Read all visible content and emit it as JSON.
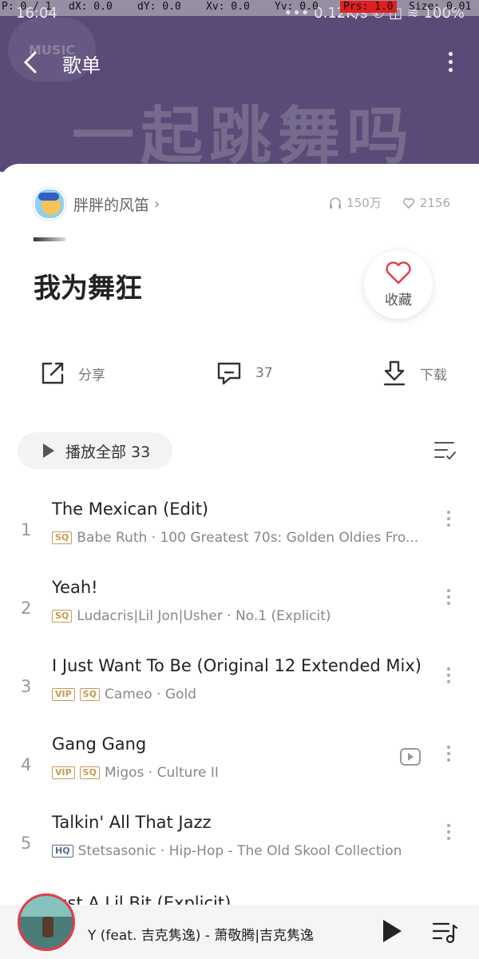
{
  "debug": {
    "p": "P: 0 / 1",
    "dx": "dX: 0.0",
    "dy": "dY: 0.0",
    "xv": "Xv: 0.0",
    "yv": "Yv: 0.0",
    "prs": "Prs: 1.0",
    "size": "Size: 0.01"
  },
  "status": {
    "time": "16:04",
    "right": "••• 0.12K/s  ✆  ◫  ≋  100%"
  },
  "header": {
    "logo_text": "MUSIC",
    "title": "歌单",
    "background_title": "一起跳舞吗"
  },
  "creator": {
    "name": "胖胖的风笛",
    "plays": "150万",
    "likes": "2156"
  },
  "playlist": {
    "title": "我为舞狂",
    "favorite_label": "收藏"
  },
  "actions": {
    "share_label": "分享",
    "comment_count": "37",
    "download_label": "下载"
  },
  "play_all": {
    "label": "播放全部 33"
  },
  "songs": [
    {
      "index": "1",
      "name": "The Mexican (Edit)",
      "badges": [
        "SQ"
      ],
      "meta": "Babe Ruth · 100 Greatest 70s: Golden Oldies Fro..."
    },
    {
      "index": "2",
      "name": "Yeah!",
      "badges": [
        "SQ"
      ],
      "meta": "Ludacris|Lil Jon|Usher · No.1 (Explicit)"
    },
    {
      "index": "3",
      "name": "I Just Want To Be (Original 12 Extended Mix)",
      "badges": [
        "VIP",
        "SQ"
      ],
      "meta": "Cameo · Gold"
    },
    {
      "index": "4",
      "name": "Gang Gang",
      "badges": [
        "VIP",
        "SQ"
      ],
      "meta": "Migos · Culture II"
    },
    {
      "index": "5",
      "name": "Talkin' All That Jazz",
      "badges": [
        "HQ"
      ],
      "meta": "Stetsasonic · Hip-Hop - The Old Skool Collection"
    }
  ],
  "partial_song": "Just A Lil Bit (Explicit)",
  "mini_player": {
    "now_playing": "Y (feat. 吉克隽逸) - 萧敬腾|吉克隽逸"
  },
  "colors": {
    "header_bg": "#5a4a78",
    "accent_red": "#e73a4a",
    "badge_gold": "#c79a52"
  }
}
